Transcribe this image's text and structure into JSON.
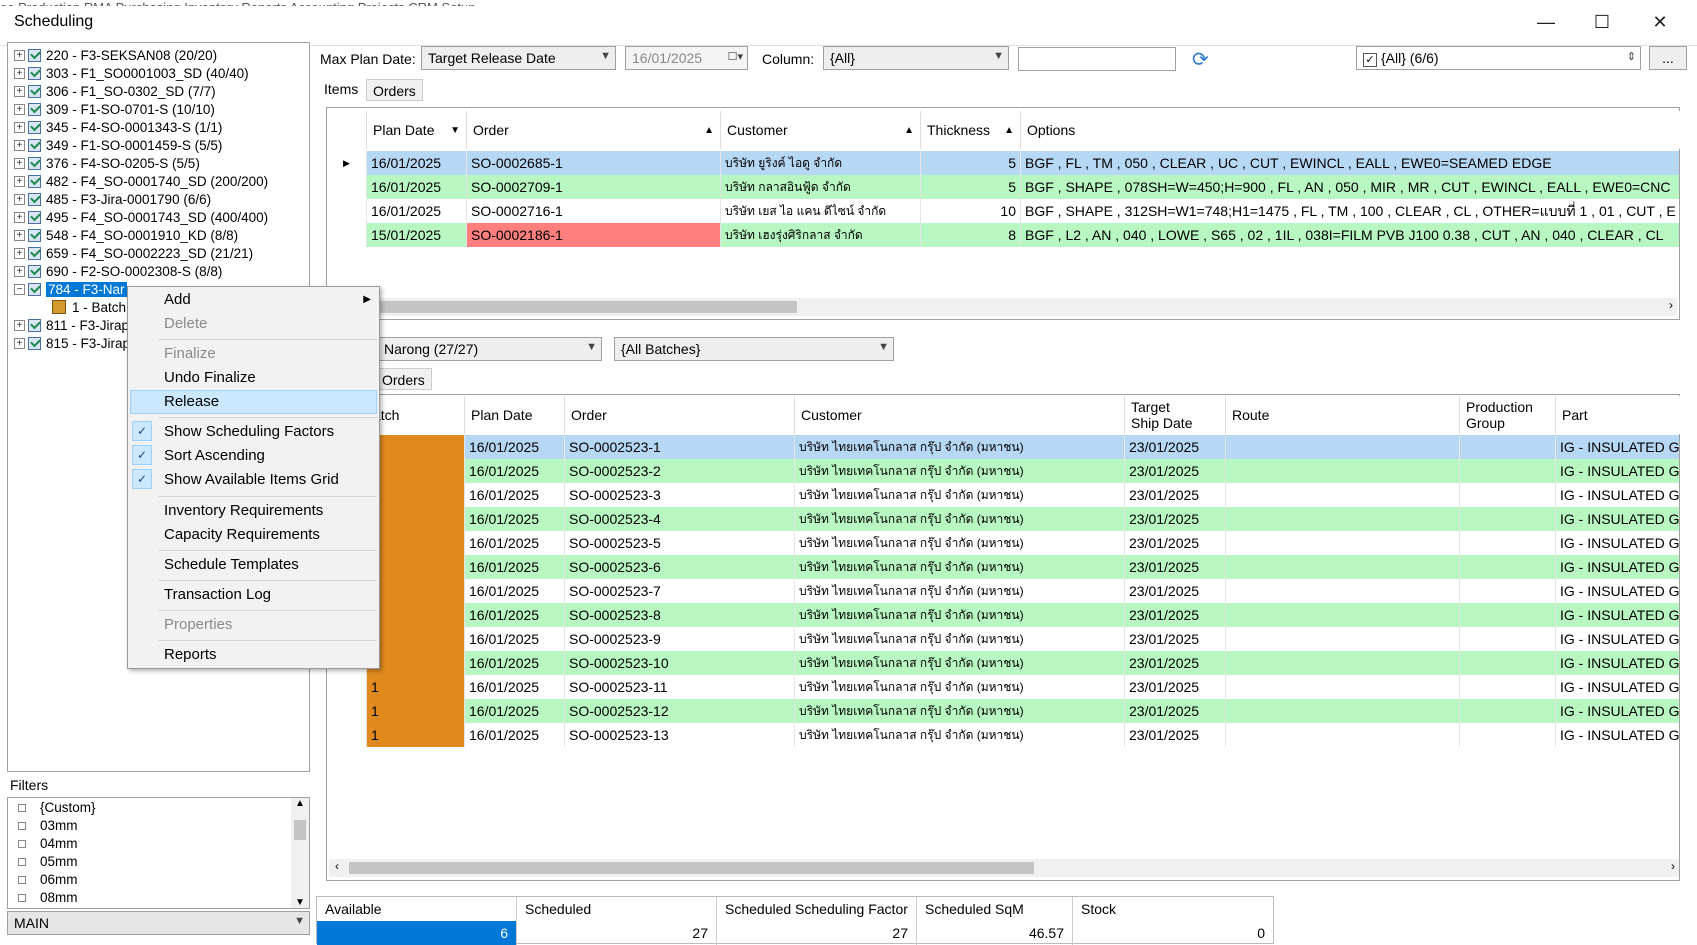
{
  "window": {
    "title": "Scheduling",
    "menu_partial": "ee  Production  RMA  Purchasing  Inventory  Reports  Accounting  Projects  CRM  Setup"
  },
  "tree": {
    "items": [
      {
        "label": "220 - F3-SEKSAN08 (20/20)"
      },
      {
        "label": "303 - F1_SO0001003_SD (40/40)"
      },
      {
        "label": "306 - F1_SO-0302_SD (7/7)"
      },
      {
        "label": "309 - F1-SO-0701-S (10/10)"
      },
      {
        "label": "345 - F4-SO-0001343-S (1/1)"
      },
      {
        "label": "349 - F1-SO-0001459-S (5/5)"
      },
      {
        "label": "376 - F4-SO-0205-S (5/5)"
      },
      {
        "label": "482 - F4_SO-0001740_SD (200/200)"
      },
      {
        "label": "485 - F3-Jira-0001790 (6/6)"
      },
      {
        "label": "495 - F4_SO-0001743_SD (400/400)"
      },
      {
        "label": "548 - F4_SO-0001910_KD (8/8)"
      },
      {
        "label": "659 - F4_SO-0002223_SD (21/21)"
      },
      {
        "label": "690 - F2-SO-0002308-S (8/8)"
      }
    ],
    "selected": "784 - F3-Nar",
    "child": "1 - Batch",
    "tail": [
      {
        "label": "811 - F3-Jirap"
      },
      {
        "label": "815 - F3-Jirap"
      }
    ]
  },
  "context_menu": {
    "add": "Add",
    "delete": "Delete",
    "finalize": "Finalize",
    "undo_finalize": "Undo Finalize",
    "release": "Release",
    "show_factors": "Show Scheduling Factors",
    "sort_asc": "Sort Ascending",
    "show_available": "Show Available Items Grid",
    "inv_req": "Inventory Requirements",
    "cap_req": "Capacity Requirements",
    "templates": "Schedule Templates",
    "tx_log": "Transaction Log",
    "properties": "Properties",
    "reports": "Reports"
  },
  "toolbar": {
    "max_plan_label": "Max Plan Date:",
    "max_plan_value": "Target Release Date",
    "date_value": "16/01/2025",
    "column_label": "Column:",
    "column_value": "{All}",
    "search_value": "",
    "filter_value": "{All} (6/6)",
    "more": "..."
  },
  "top_tabs": {
    "items": "Items",
    "orders": "Orders"
  },
  "top_grid": {
    "headers": {
      "plan": "Plan Date",
      "order": "Order",
      "customer": "Customer",
      "thickness": "Thickness",
      "options": "Options"
    },
    "rows": [
      {
        "plan": "16/01/2025",
        "order": "SO-0002685-1",
        "customer": "บริษัท ยูริงค์ ไอดู จำกัด",
        "thickness": "5",
        "options": "BGF , FL , TM , 050 , CLEAR , UC , CUT , EWINCL , EALL , EWE0=SEAMED EDGE"
      },
      {
        "plan": "16/01/2025",
        "order": "SO-0002709-1",
        "customer": "บริษัท กลาสอินฟู้ด จำกัด",
        "thickness": "5",
        "options": "BGF , SHAPE , 078SH=W=450;H=900 , FL , AN , 050 , MIR , MR , CUT , EWINCL , EALL , EWE0=CNC"
      },
      {
        "plan": "16/01/2025",
        "order": "SO-0002716-1",
        "customer": "บริษัท เยส ไอ แคน ดีไซน์ จำกัด",
        "thickness": "10",
        "options": "BGF , SHAPE , 312SH=W1=748;H1=1475 , FL , TM , 100 , CLEAR , CL , OTHER=แบบที่ 1 , 01 , CUT , E"
      },
      {
        "plan": "15/01/2025",
        "order": "SO-0002186-1",
        "customer": "บริษัท เฮงรุ่งศิริกลาส จำกัด",
        "thickness": "8",
        "options": "BGF , L2 , AN , 040 , LOWE , S65 , 02 , 1IL , 038I=FILM PVB J100 0.38 , CUT , AN , 040 , CLEAR , CL"
      }
    ]
  },
  "batch_bar": {
    "schedule_value": "Narong (27/27)",
    "batches_value": "{All Batches}",
    "orders_tab": "Orders"
  },
  "bottom_grid": {
    "headers": {
      "batch": "atch",
      "plan": "Plan Date",
      "order": "Order",
      "customer": "Customer",
      "ship1": "Target",
      "ship2": "Ship Date",
      "route": "Route",
      "pg1": "Production",
      "pg2": "Group",
      "part": "Part"
    },
    "rows": [
      {
        "batch": "",
        "plan": "16/01/2025",
        "order": "SO-0002523-1",
        "customer": "บริษัท ไทยเทคโนกลาส กรุ๊ป จำกัด (มหาชน)",
        "ship": "23/01/2025",
        "part": "IG - INSULATED G"
      },
      {
        "batch": "",
        "plan": "16/01/2025",
        "order": "SO-0002523-2",
        "customer": "บริษัท ไทยเทคโนกลาส กรุ๊ป จำกัด (มหาชน)",
        "ship": "23/01/2025",
        "part": "IG - INSULATED G"
      },
      {
        "batch": "",
        "plan": "16/01/2025",
        "order": "SO-0002523-3",
        "customer": "บริษัท ไทยเทคโนกลาส กรุ๊ป จำกัด (มหาชน)",
        "ship": "23/01/2025",
        "part": "IG - INSULATED G"
      },
      {
        "batch": "",
        "plan": "16/01/2025",
        "order": "SO-0002523-4",
        "customer": "บริษัท ไทยเทคโนกลาส กรุ๊ป จำกัด (มหาชน)",
        "ship": "23/01/2025",
        "part": "IG - INSULATED G"
      },
      {
        "batch": "",
        "plan": "16/01/2025",
        "order": "SO-0002523-5",
        "customer": "บริษัท ไทยเทคโนกลาส กรุ๊ป จำกัด (มหาชน)",
        "ship": "23/01/2025",
        "part": "IG - INSULATED G"
      },
      {
        "batch": "",
        "plan": "16/01/2025",
        "order": "SO-0002523-6",
        "customer": "บริษัท ไทยเทคโนกลาส กรุ๊ป จำกัด (มหาชน)",
        "ship": "23/01/2025",
        "part": "IG - INSULATED G"
      },
      {
        "batch": "",
        "plan": "16/01/2025",
        "order": "SO-0002523-7",
        "customer": "บริษัท ไทยเทคโนกลาส กรุ๊ป จำกัด (มหาชน)",
        "ship": "23/01/2025",
        "part": "IG - INSULATED G"
      },
      {
        "batch": "",
        "plan": "16/01/2025",
        "order": "SO-0002523-8",
        "customer": "บริษัท ไทยเทคโนกลาส กรุ๊ป จำกัด (มหาชน)",
        "ship": "23/01/2025",
        "part": "IG - INSULATED G"
      },
      {
        "batch": "",
        "plan": "16/01/2025",
        "order": "SO-0002523-9",
        "customer": "บริษัท ไทยเทคโนกลาส กรุ๊ป จำกัด (มหาชน)",
        "ship": "23/01/2025",
        "part": "IG - INSULATED G"
      },
      {
        "batch": "",
        "plan": "16/01/2025",
        "order": "SO-0002523-10",
        "customer": "บริษัท ไทยเทคโนกลาส กรุ๊ป จำกัด (มหาชน)",
        "ship": "23/01/2025",
        "part": "IG - INSULATED G"
      },
      {
        "batch": "1",
        "plan": "16/01/2025",
        "order": "SO-0002523-11",
        "customer": "บริษัท ไทยเทคโนกลาส กรุ๊ป จำกัด (มหาชน)",
        "ship": "23/01/2025",
        "part": "IG - INSULATED G"
      },
      {
        "batch": "1",
        "plan": "16/01/2025",
        "order": "SO-0002523-12",
        "customer": "บริษัท ไทยเทคโนกลาส กรุ๊ป จำกัด (มหาชน)",
        "ship": "23/01/2025",
        "part": "IG - INSULATED G"
      },
      {
        "batch": "1",
        "plan": "16/01/2025",
        "order": "SO-0002523-13",
        "customer": "บริษัท ไทยเทคโนกลาส กรุ๊ป จำกัด (มหาชน)",
        "ship": "23/01/2025",
        "part": "IG - INSULATED G"
      }
    ]
  },
  "filters": {
    "title": "Filters",
    "items": [
      "{Custom}",
      "03mm",
      "04mm",
      "05mm",
      "06mm",
      "08mm"
    ],
    "location": "MAIN"
  },
  "stats": {
    "available_label": "Available",
    "available": "6",
    "scheduled_label": "Scheduled",
    "scheduled": "27",
    "factor_label": "Scheduled Scheduling Factor",
    "factor": "27",
    "sqm_label": "Scheduled SqM",
    "sqm": "46.57",
    "stock_label": "Stock",
    "stock": "0"
  },
  "colors": {
    "selected": "#0078d7",
    "green_row": "#b9f7c2",
    "blue_row": "#b7d8f5",
    "red_cell": "#ff7f7f",
    "batch_orange": "#e08a1e"
  }
}
